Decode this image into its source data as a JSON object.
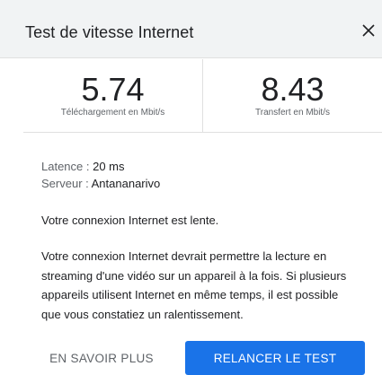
{
  "dialog": {
    "title": "Test de vitesse Internet",
    "close_icon": "close-icon"
  },
  "metrics": {
    "download": {
      "value": "5.74",
      "label": "Téléchargement en Mbit/s"
    },
    "upload": {
      "value": "8.43",
      "label": "Transfert en Mbit/s"
    }
  },
  "info": {
    "latency_label": "Latence : ",
    "latency_value": "20 ms",
    "server_label": "Serveur : ",
    "server_value": "Antananarivo"
  },
  "messages": {
    "status": "Votre connexion Internet est lente.",
    "details": "Votre connexion Internet devrait permettre la lecture en streaming d'une vidéo sur un appareil à la fois. Si plusieurs appareils utilisent Internet en même temps, il est possible que vous constatiez un ralentissement."
  },
  "actions": {
    "learn_more": "EN SAVOIR PLUS",
    "retest": "RELANCER LE TEST"
  },
  "colors": {
    "accent": "#1a73e8",
    "header_bg": "#f1f3f4"
  }
}
